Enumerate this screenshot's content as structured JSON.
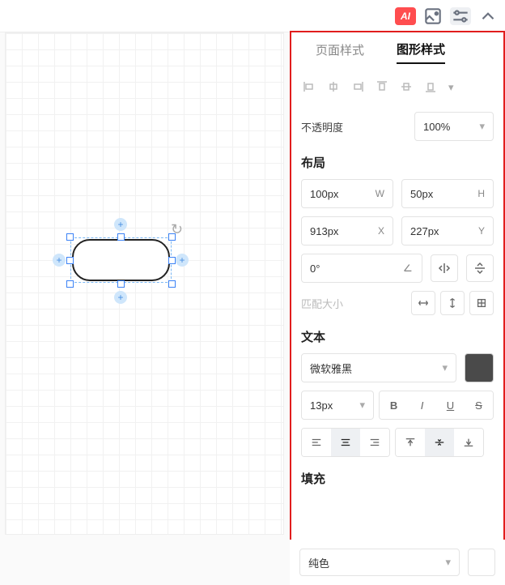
{
  "topbar": {
    "ai_label": "AI"
  },
  "tabs": {
    "page": "页面样式",
    "shape": "图形样式"
  },
  "opacity": {
    "label": "不透明度",
    "value": "100%"
  },
  "layout": {
    "title": "布局",
    "w_value": "100px",
    "w_suffix": "W",
    "h_value": "50px",
    "h_suffix": "H",
    "x_value": "913px",
    "x_suffix": "X",
    "y_value": "227px",
    "y_suffix": "Y",
    "angle_value": "0°",
    "match_size_label": "匹配大小"
  },
  "text": {
    "title": "文本",
    "font_family": "微软雅黑",
    "font_size": "13px",
    "text_color": "#4a4a4a"
  },
  "fill": {
    "title": "填充",
    "type": "纯色",
    "color": "#ffffff"
  }
}
